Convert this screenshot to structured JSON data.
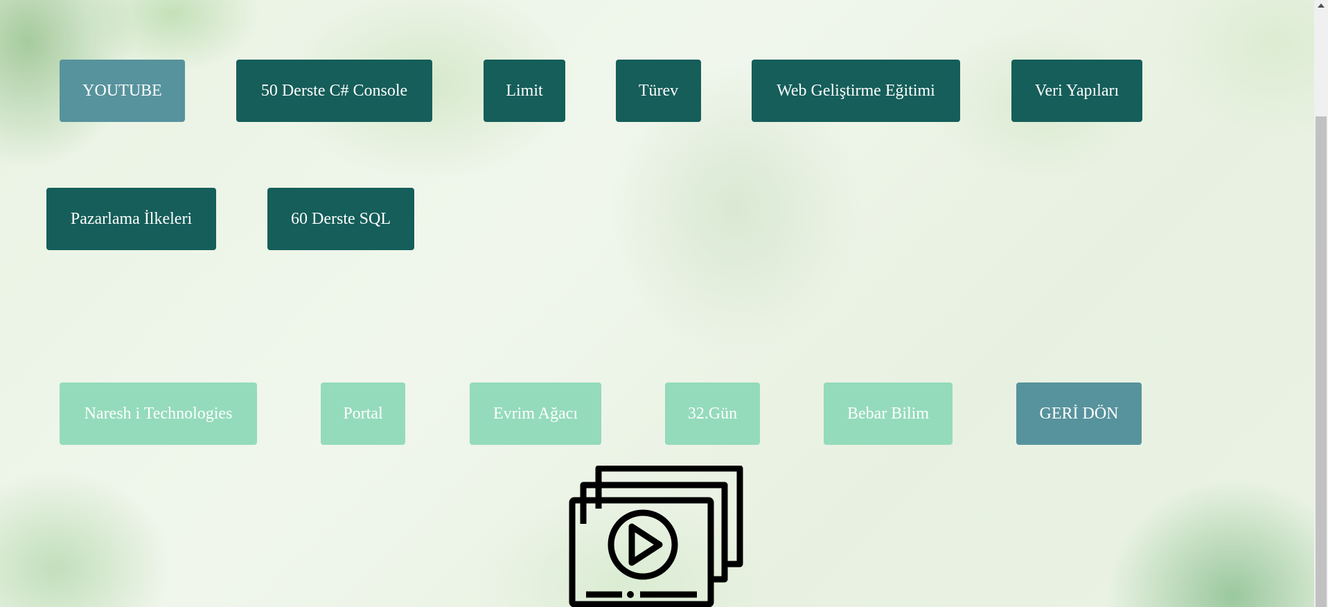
{
  "top_buttons": [
    {
      "label": "YOUTUBE",
      "variant": "teal"
    },
    {
      "label": "50 Derste C# Console",
      "variant": "dark"
    },
    {
      "label": "Limit",
      "variant": "dark"
    },
    {
      "label": "Türev",
      "variant": "dark"
    },
    {
      "label": "Web Geliştirme Eğitimi",
      "variant": "dark"
    },
    {
      "label": "Veri Yapıları",
      "variant": "dark"
    },
    {
      "label": "Pazarlama İlkeleri",
      "variant": "dark"
    },
    {
      "label": "60 Derste SQL",
      "variant": "dark"
    }
  ],
  "bottom_buttons": [
    {
      "label": "Naresh i Technologies",
      "variant": "mint"
    },
    {
      "label": "Portal",
      "variant": "mint"
    },
    {
      "label": "Evrim Ağacı",
      "variant": "mint"
    },
    {
      "label": "32.Gün",
      "variant": "mint"
    },
    {
      "label": "Bebar Bilim",
      "variant": "mint"
    },
    {
      "label": "GERİ DÖN",
      "variant": "teal"
    }
  ],
  "colors": {
    "dark_button": "#155e5a",
    "teal_button": "#57939d",
    "mint_button": "#94dbbb",
    "button_text": "#ffffff"
  },
  "icons": {
    "video_library": "video-library-icon"
  }
}
